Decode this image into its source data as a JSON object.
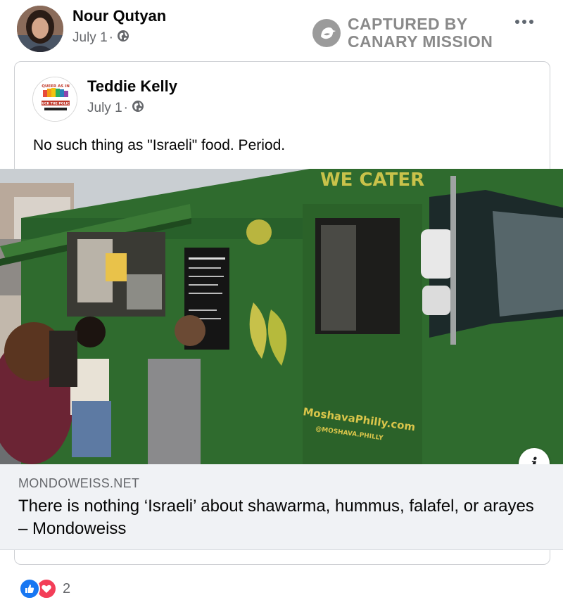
{
  "post": {
    "author": "Nour Qutyan",
    "date": "July 1",
    "meta_sep": " · ",
    "more_label": "More options"
  },
  "capture_badge": {
    "line1": "CAPTURED BY",
    "line2": "CANARY MISSION"
  },
  "shared_post": {
    "author": "Teddie Kelly",
    "date": "July 1",
    "meta_sep": " · ",
    "text": "No such thing as \"Israeli\" food. Period.",
    "avatar_text": [
      "QUEER AS IN",
      "FUCK THE POLICE"
    ]
  },
  "link_preview": {
    "photo_sign": "WE CATER",
    "truck_website": "MoshavaPhilly.com",
    "truck_handle": "@MOSHAVA.PHILLY",
    "domain": "MONDOWEISS.NET",
    "title": "There is nothing ‘Israeli’ about shawarma, hummus, falafel, or arayes – Mondoweiss",
    "info_icon": "i"
  },
  "reactions": {
    "types": [
      "like",
      "love"
    ],
    "count": "2"
  },
  "colors": {
    "fb_blue": "#1877f2",
    "love_red": "#f33e58",
    "meta_gray": "#65676b",
    "truck_green": "#2f6b2e"
  }
}
